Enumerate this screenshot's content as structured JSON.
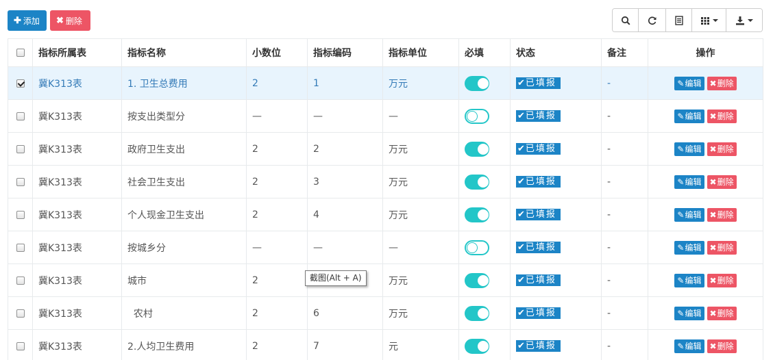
{
  "toolbar": {
    "add_label": "添加",
    "delete_label": "删除",
    "tools": [
      "search-icon",
      "refresh-icon",
      "toggle-view-icon",
      "columns-icon",
      "export-icon"
    ]
  },
  "table": {
    "headers": [
      "指标所属表",
      "指标名称",
      "小数位",
      "指标编码",
      "指标单位",
      "必填",
      "状态",
      "备注",
      "操作"
    ],
    "rows": [
      {
        "checked": true,
        "table": "冀K313表",
        "name": "1. 卫生总费用",
        "decimals": "2",
        "code": "1",
        "unit": "万元",
        "required": true,
        "status": "已填报",
        "remark": "-"
      },
      {
        "checked": false,
        "table": "冀K313表",
        "name": "按支出类型分",
        "decimals": "—",
        "code": "—",
        "unit": "—",
        "required": false,
        "status": "已填报",
        "remark": "-"
      },
      {
        "checked": false,
        "table": "冀K313表",
        "name": "政府卫生支出",
        "decimals": "2",
        "code": "2",
        "unit": "万元",
        "required": true,
        "status": "已填报",
        "remark": "-"
      },
      {
        "checked": false,
        "table": "冀K313表",
        "name": "社会卫生支出",
        "decimals": "2",
        "code": "3",
        "unit": "万元",
        "required": true,
        "status": "已填报",
        "remark": "-"
      },
      {
        "checked": false,
        "table": "冀K313表",
        "name": "个人现金卫生支出",
        "decimals": "2",
        "code": "4",
        "unit": "万元",
        "required": true,
        "status": "已填报",
        "remark": "-"
      },
      {
        "checked": false,
        "table": "冀K313表",
        "name": "按城乡分",
        "decimals": "—",
        "code": "—",
        "unit": "—",
        "required": false,
        "status": "已填报",
        "remark": "-"
      },
      {
        "checked": false,
        "table": "冀K313表",
        "name": "城市",
        "decimals": "2",
        "code": "",
        "unit": "万元",
        "required": true,
        "status": "已填报",
        "remark": "-"
      },
      {
        "checked": false,
        "table": "冀K313表",
        "name": "  农村",
        "decimals": "2",
        "code": "6",
        "unit": "万元",
        "required": true,
        "status": "已填报",
        "remark": "-"
      },
      {
        "checked": false,
        "table": "冀K313表",
        "name": "2.人均卫生费用",
        "decimals": "2",
        "code": "7",
        "unit": "元",
        "required": true,
        "status": "已填报",
        "remark": "-"
      }
    ],
    "edit_label": "编辑",
    "delete_label": "删除"
  },
  "tooltip": "截图(Alt + A)",
  "colors": {
    "primary": "#1c84c6",
    "danger": "#ed5565",
    "switch": "#23c6c8",
    "selected_row": "#e8f4fd"
  }
}
